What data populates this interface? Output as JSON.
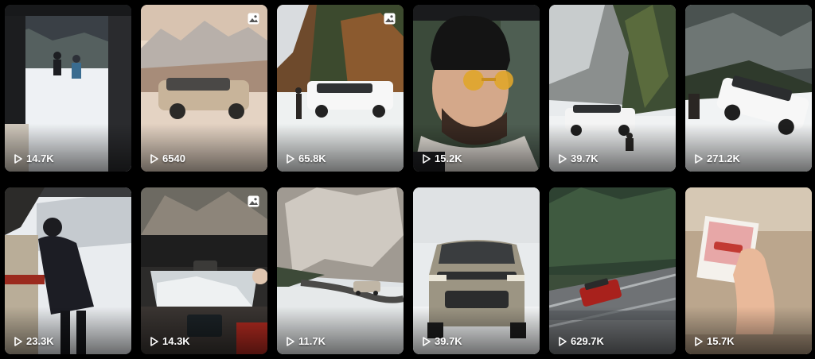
{
  "grid": {
    "tiles": [
      {
        "views": "14.7K",
        "is_photo": false
      },
      {
        "views": "6540",
        "is_photo": true
      },
      {
        "views": "65.8K",
        "is_photo": true
      },
      {
        "views": "15.2K",
        "is_photo": false
      },
      {
        "views": "39.7K",
        "is_photo": false
      },
      {
        "views": "271.2K",
        "is_photo": false
      },
      {
        "views": "23.3K",
        "is_photo": false
      },
      {
        "views": "14.3K",
        "is_photo": true
      },
      {
        "views": "11.7K",
        "is_photo": false
      },
      {
        "views": "39.7K",
        "is_photo": false
      },
      {
        "views": "629.7K",
        "is_photo": false
      },
      {
        "views": "15.7K",
        "is_photo": false
      }
    ]
  },
  "icons": {
    "play": "play-icon",
    "photo": "image-icon"
  }
}
